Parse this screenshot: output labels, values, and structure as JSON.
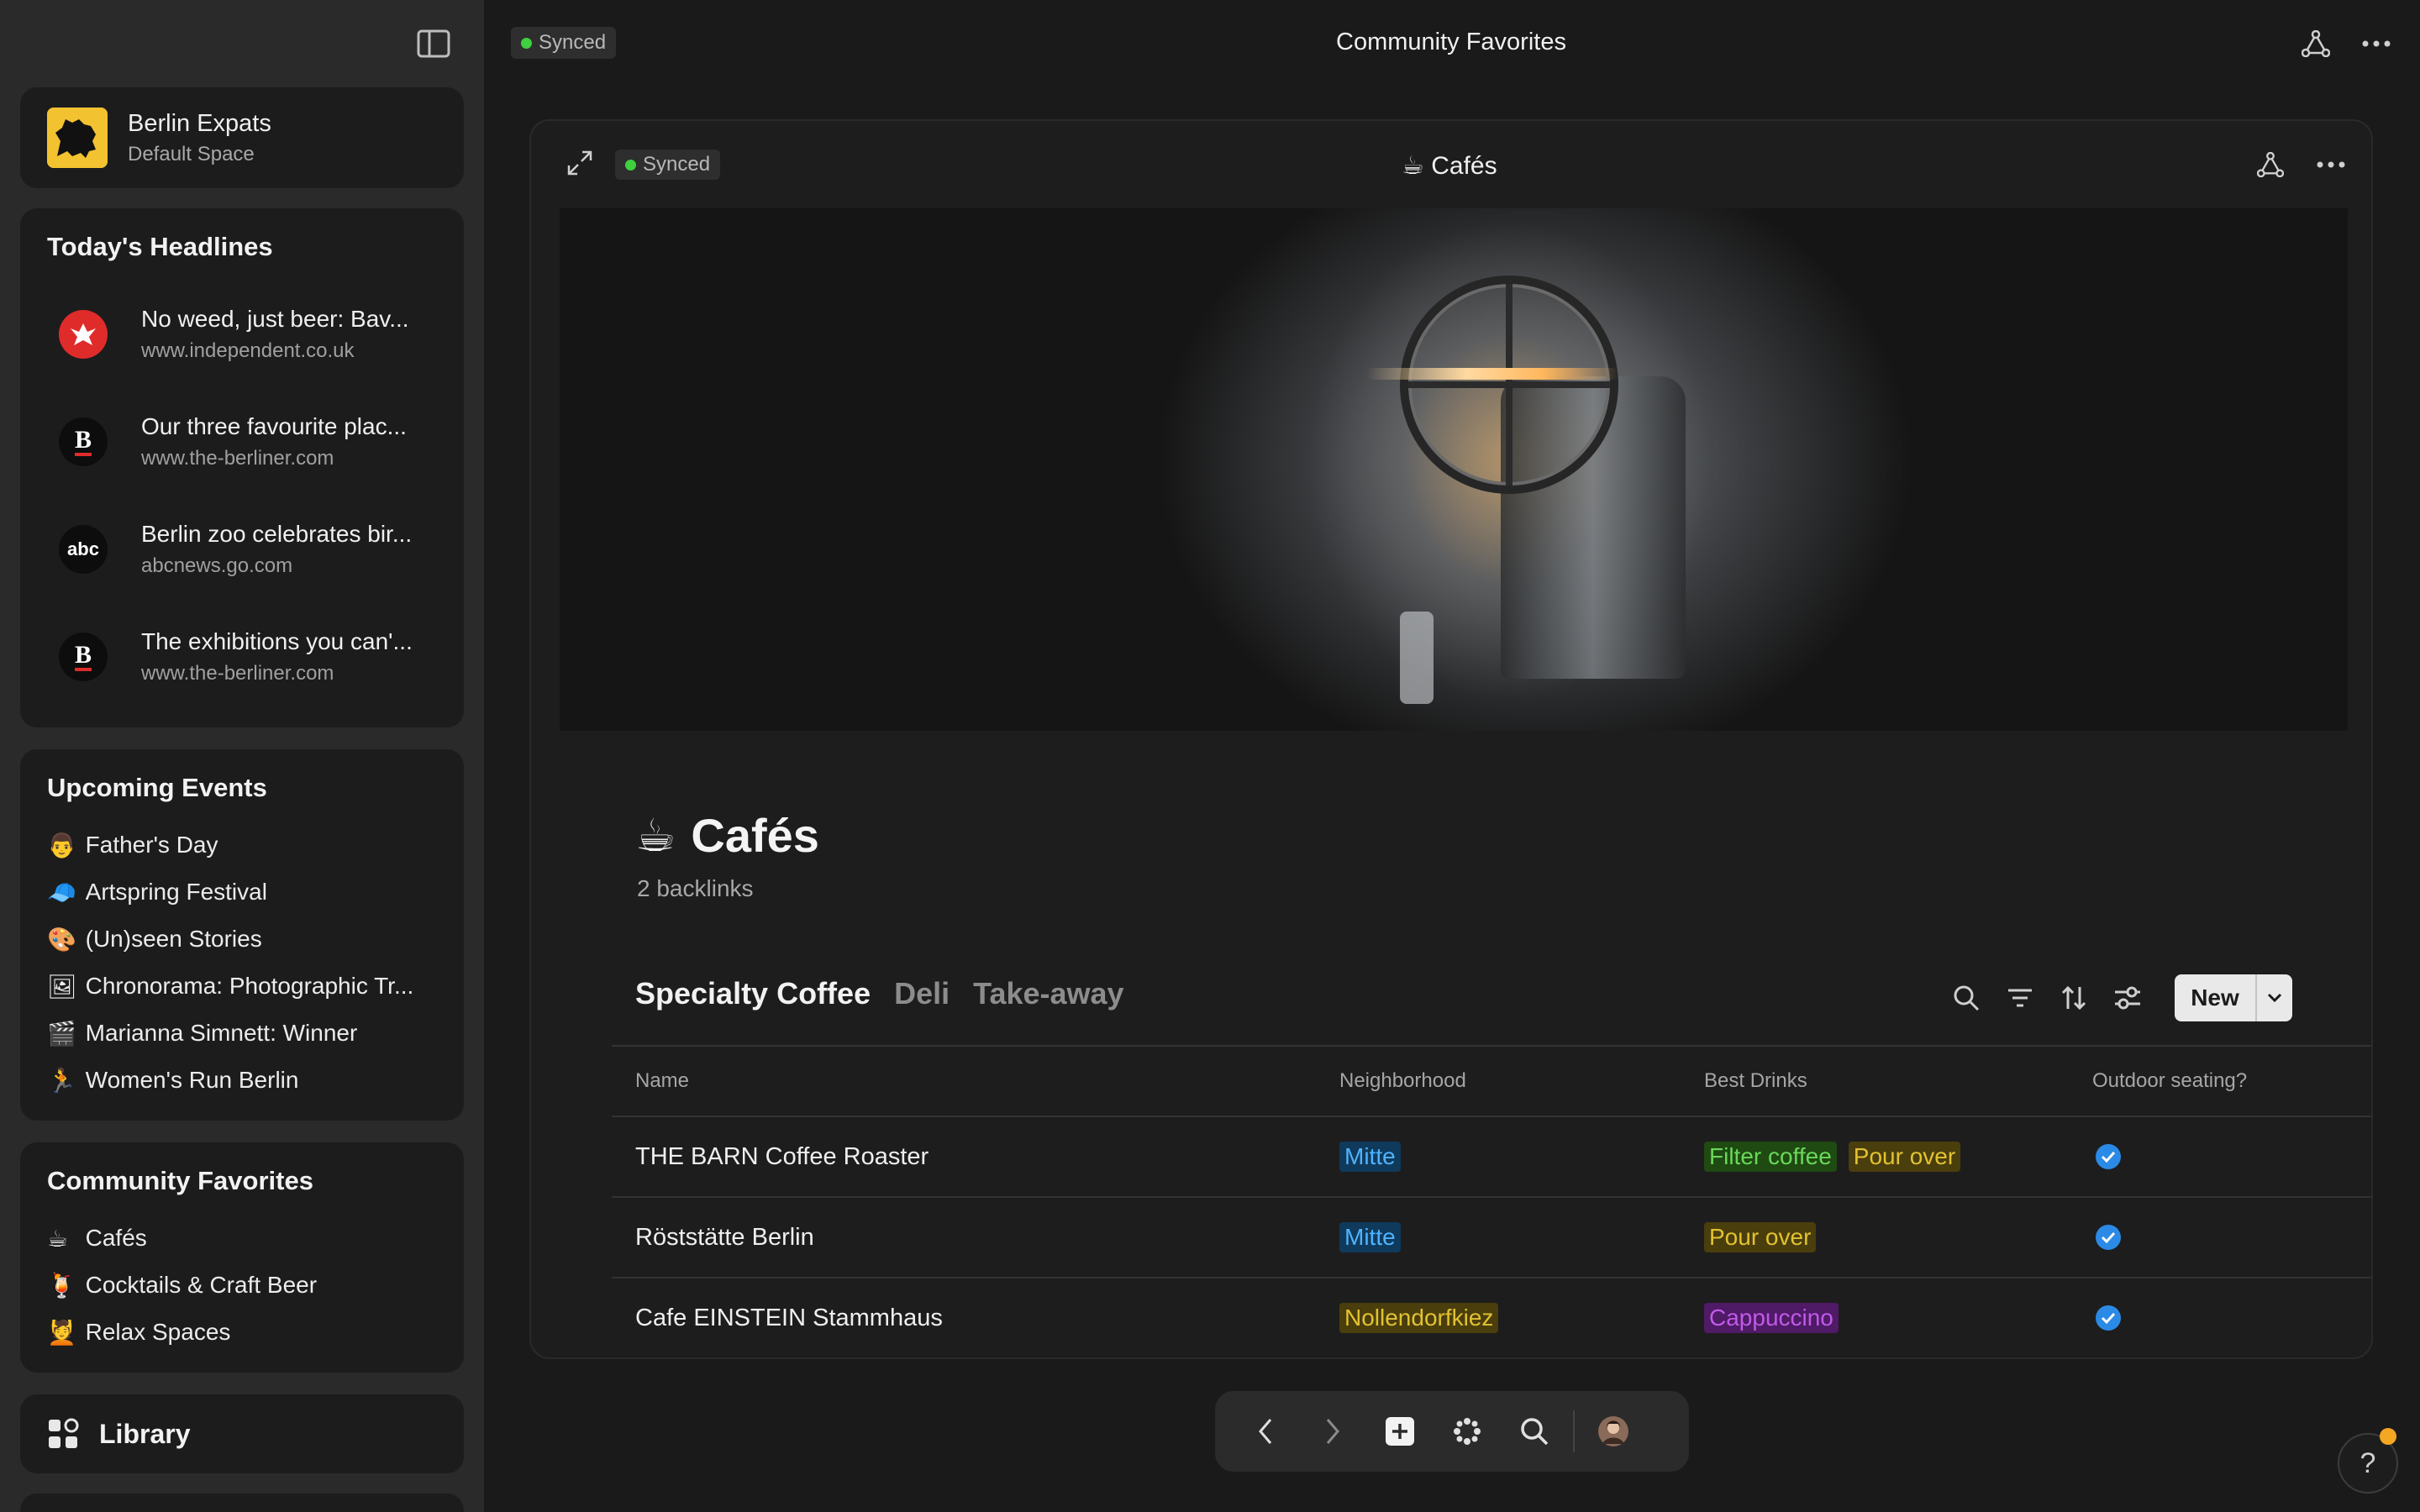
{
  "window": {
    "title": "Community Favorites",
    "sync_status": "Synced"
  },
  "space": {
    "name": "Berlin Expats",
    "subtitle": "Default Space",
    "logo_icon": "bear-flag-icon"
  },
  "headlines": {
    "title": "Today's Headlines",
    "items": [
      {
        "title": "No weed, just beer: Bav...",
        "url": "www.independent.co.uk",
        "icon": "eagle-icon",
        "icon_color": "#e02b2b"
      },
      {
        "title": "Our three favourite plac...",
        "url": "www.the-berliner.com",
        "icon": "berliner-b-icon",
        "icon_color": "#0d0d0d"
      },
      {
        "title": "Berlin zoo celebrates bir...",
        "url": "abcnews.go.com",
        "icon": "abc-icon",
        "icon_color": "#0d0d0d"
      },
      {
        "title": "The exhibitions you can'...",
        "url": "www.the-berliner.com",
        "icon": "berliner-b-icon",
        "icon_color": "#0d0d0d"
      }
    ]
  },
  "events": {
    "title": "Upcoming Events",
    "items": [
      {
        "emoji": "👨",
        "label": "Father's Day"
      },
      {
        "emoji": "🧢",
        "label": "Artspring Festival"
      },
      {
        "emoji": "🎨",
        "label": "(Un)seen Stories"
      },
      {
        "emoji": "🖼",
        "label": "Chronorama: Photographic Tr..."
      },
      {
        "emoji": "🎬",
        "label": "Marianna Simnett: Winner"
      },
      {
        "emoji": "🏃",
        "label": "Women's Run Berlin"
      }
    ]
  },
  "favorites": {
    "title": "Community Favorites",
    "items": [
      {
        "emoji": "☕",
        "label": "Cafés"
      },
      {
        "emoji": "🍹",
        "label": "Cocktails & Craft Beer"
      },
      {
        "emoji": "💆",
        "label": "Relax Spaces"
      }
    ]
  },
  "library": {
    "label": "Library"
  },
  "panel": {
    "sync_status": "Synced",
    "title": "☕ Cafés",
    "page_emoji": "☕",
    "page_title": "Cafés",
    "backlinks": "2 backlinks"
  },
  "tabs": [
    {
      "label": "Specialty Coffee",
      "active": true
    },
    {
      "label": "Deli",
      "active": false
    },
    {
      "label": "Take-away",
      "active": false
    }
  ],
  "toolbar": {
    "new_label": "New"
  },
  "table": {
    "headers": [
      "Name",
      "Neighborhood",
      "Best Drinks",
      "Outdoor seating?"
    ],
    "rows": [
      {
        "name": "THE BARN Coffee Roaster",
        "neighborhood": "Mitte",
        "drinks": [
          "Filter coffee",
          "Pour over"
        ],
        "outdoor": true
      },
      {
        "name": "Röststätte Berlin",
        "neighborhood": "Mitte",
        "drinks": [
          "Pour over"
        ],
        "outdoor": true
      },
      {
        "name": "Cafe EINSTEIN Stammhaus",
        "neighborhood": "Nollendorfkiez",
        "drinks": [
          "Cappuccino"
        ],
        "outdoor": true
      }
    ]
  },
  "tag_colors": {
    "Mitte": {
      "bg": "#0f3a5c",
      "fg": "#4fb3ff"
    },
    "Nollendorfkiez": {
      "bg": "#4a3e0c",
      "fg": "#e2c232"
    },
    "Filter coffee": {
      "bg": "#1f4a12",
      "fg": "#6ad85a"
    },
    "Pour over": {
      "bg": "#4a3e0c",
      "fg": "#e2c232"
    },
    "Cappuccino": {
      "bg": "#4f1a66",
      "fg": "#c05ae8"
    }
  }
}
